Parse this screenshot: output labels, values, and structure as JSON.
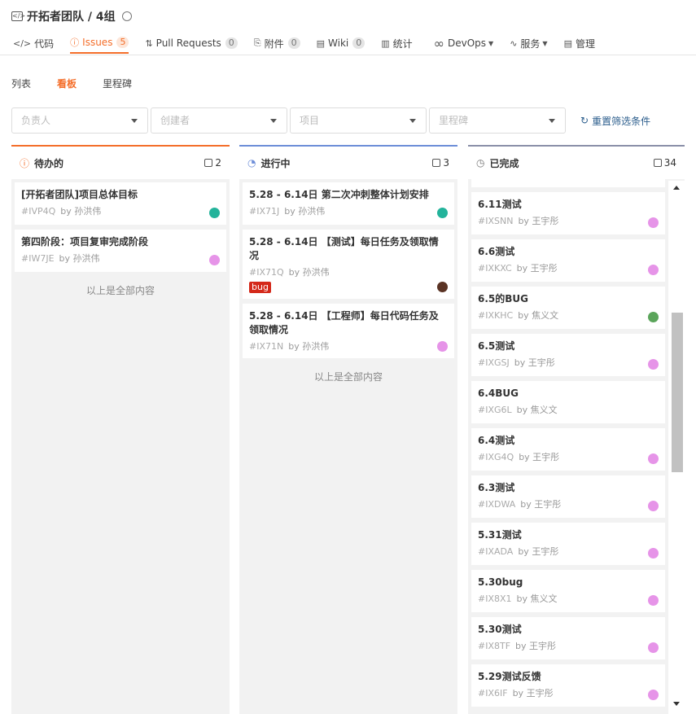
{
  "repo": {
    "title": "开拓者团队 / 4组"
  },
  "nav": [
    {
      "icon": "</>",
      "label": "代码",
      "count": null
    },
    {
      "icon": "ⓘ",
      "label": "Issues",
      "count": "5"
    },
    {
      "icon": "⇅",
      "label": "Pull Requests",
      "count": "0"
    },
    {
      "icon": "⎘",
      "label": "附件",
      "count": "0"
    },
    {
      "icon": "▤",
      "label": "Wiki",
      "count": "0"
    },
    {
      "icon": "▥",
      "label": "统计",
      "count": null
    },
    {
      "icon": "∞",
      "label": "DevOps",
      "count": null
    },
    {
      "icon": "∿",
      "label": "服务",
      "count": null
    },
    {
      "icon": "▤",
      "label": "管理",
      "count": null
    }
  ],
  "subtabs": [
    "列表",
    "看板",
    "里程碑"
  ],
  "filters": [
    "负责人",
    "创建者",
    "项目",
    "里程碑"
  ],
  "reset_label": "重置筛选条件",
  "colors": {
    "accent": "#f46e2a",
    "todo": "#f46e2a",
    "doing": "#6d8ed8",
    "done": "#8a8fa8"
  },
  "columns": [
    {
      "title": "待办的",
      "count": "2",
      "cards": [
        {
          "title": "[开拓者团队]项目总体目标",
          "id": "#IVP4Q",
          "by": "by 孙洪伟",
          "avatar": "#23b39b"
        },
        {
          "title": "第四阶段：项目复审完成阶段",
          "id": "#IW7JE",
          "by": "by 孙洪伟",
          "avatar": "#e694e8"
        }
      ],
      "end": "以上是全部内容"
    },
    {
      "title": "进行中",
      "count": "3",
      "cards": [
        {
          "title": "5.28 - 6.14日 第二次冲刺整体计划安排",
          "id": "#IX71J",
          "by": "by 孙洪伟",
          "avatar": "#23b39b"
        },
        {
          "title": "5.28 - 6.14日 【测试】每日任务及领取情况",
          "id": "#IX71Q",
          "by": "by 孙洪伟",
          "avatar": "#5a3324",
          "tag": "bug"
        },
        {
          "title": "5.28 - 6.14日 【工程师】每日代码任务及领取情况",
          "id": "#IX71N",
          "by": "by 孙洪伟",
          "avatar": "#e694e8"
        }
      ],
      "end": "以上是全部内容"
    },
    {
      "title": "已完成",
      "count": "34",
      "cards": [
        {
          "title": "6.11测试",
          "id": "#IXSNN",
          "by": "by 王宇彤",
          "avatar": "#e694e8"
        },
        {
          "title": "6.6测试",
          "id": "#IXKXC",
          "by": "by 王宇彤",
          "avatar": "#e694e8"
        },
        {
          "title": "6.5的BUG",
          "id": "#IXKHC",
          "by": "by 焦义文",
          "avatar": "#5ba55b"
        },
        {
          "title": "6.5测试",
          "id": "#IXGSJ",
          "by": "by 王宇彤",
          "avatar": "#e694e8"
        },
        {
          "title": "6.4BUG",
          "id": "#IXG6L",
          "by": "by 焦义文",
          "avatar": null
        },
        {
          "title": "6.4测试",
          "id": "#IXG4Q",
          "by": "by 王宇彤",
          "avatar": "#e694e8"
        },
        {
          "title": "6.3测试",
          "id": "#IXDWA",
          "by": "by 王宇彤",
          "avatar": "#e694e8"
        },
        {
          "title": "5.31测试",
          "id": "#IXADA",
          "by": "by 王宇彤",
          "avatar": "#e694e8"
        },
        {
          "title": "5.30bug",
          "id": "#IX8X1",
          "by": "by 焦义文",
          "avatar": "#e694e8"
        },
        {
          "title": "5.30测试",
          "id": "#IX8TF",
          "by": "by 王宇彤",
          "avatar": "#e694e8"
        },
        {
          "title": "5.29测试反馈",
          "id": "#IX6IF",
          "by": "by 王宇彤",
          "avatar": "#e694e8"
        }
      ]
    }
  ]
}
